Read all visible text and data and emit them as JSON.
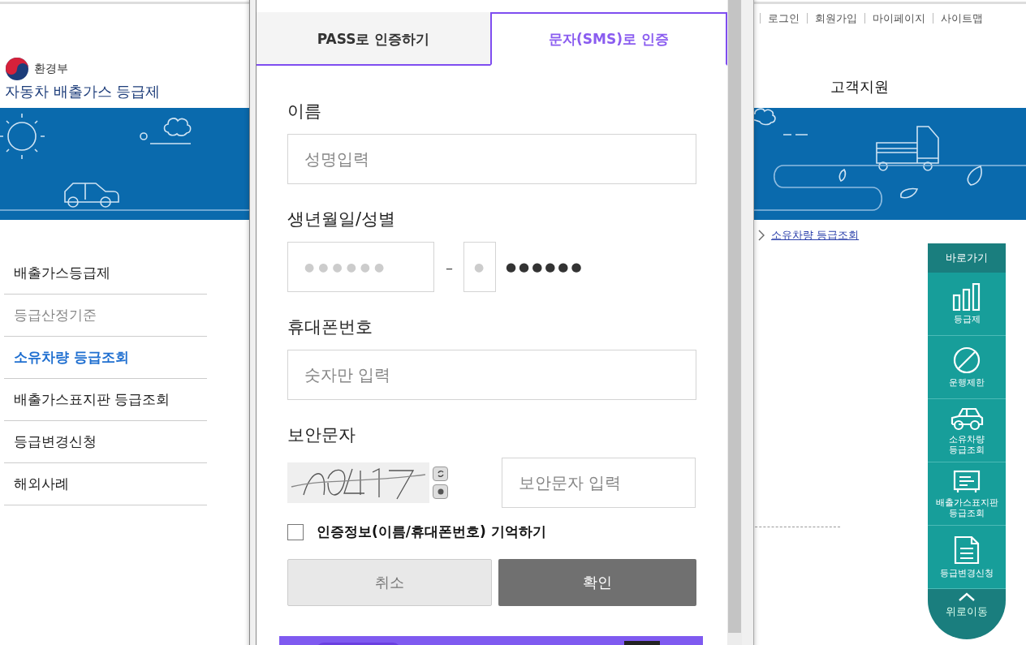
{
  "top_links": [
    "로그인",
    "회원가입",
    "마이페이지",
    "사이트맵"
  ],
  "logo": {
    "ministry": "환경부",
    "title": "자동차 배출가스 등급제"
  },
  "nav": {
    "item": "고객지원"
  },
  "sidebar": {
    "items": [
      {
        "label": "배출가스등급제",
        "selected": false,
        "dimmed": false
      },
      {
        "label": "등급산정기준",
        "selected": false,
        "dimmed": true
      },
      {
        "label": "소유차량 등급조회",
        "selected": true,
        "dimmed": false
      },
      {
        "label": "배출가스표지판 등급조회",
        "selected": false,
        "dimmed": false
      },
      {
        "label": "등급변경신청",
        "selected": false,
        "dimmed": false
      },
      {
        "label": "해외사례",
        "selected": false,
        "dimmed": false
      }
    ]
  },
  "breadcrumb": {
    "current": "소유차량 등급조회"
  },
  "quick_nav": {
    "title": "바로가기",
    "items": [
      {
        "kind": "chart",
        "lines": [
          "등급제"
        ]
      },
      {
        "kind": "ban",
        "lines": [
          "운행제한"
        ]
      },
      {
        "kind": "car",
        "lines": [
          "소유차량",
          "등급조회"
        ]
      },
      {
        "kind": "sign",
        "lines": [
          "배출가스표지판",
          "등급조회"
        ]
      },
      {
        "kind": "document",
        "lines": [
          "등급변경신청"
        ]
      }
    ],
    "top_button": "위로이동"
  },
  "popup": {
    "tabs": [
      {
        "label": "PASS로 인증하기",
        "selected": false
      },
      {
        "label": "문자(SMS)로 인증",
        "selected": true
      }
    ],
    "name": {
      "label": "이름",
      "placeholder": "성명입력"
    },
    "birth": {
      "label": "생년월일/성별",
      "birth_placeholder": "●●●●●●",
      "separator": "–",
      "gender_placeholder": "●",
      "masked": "●●●●●●"
    },
    "phone": {
      "label": "휴대폰번호",
      "placeholder": "숫자만 입력"
    },
    "captcha": {
      "label": "보안문자",
      "placeholder": "보안문자 입력"
    },
    "remember": {
      "label": "인증정보(이름/휴대폰번호) 기억하기",
      "checked": false
    },
    "buttons": {
      "cancel": "취소",
      "confirm": "확인"
    }
  }
}
